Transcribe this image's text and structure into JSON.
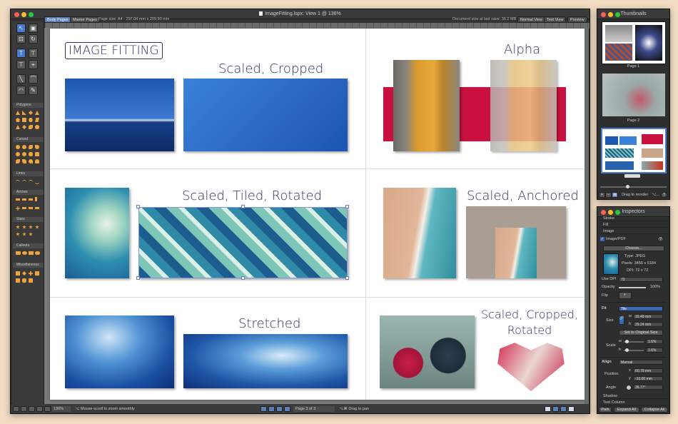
{
  "main_window": {
    "title": "ImageFitting.lspx: View 1 @ 136%",
    "tabs": {
      "body_pages": "Body Pages",
      "master_pages": "Master Pages"
    },
    "page_size": "Page size:  A4 - 297.04 mm x 209.90 mm",
    "doc_size": "Document size at last save:  36.2 MB",
    "view_buttons": {
      "normal": "Normal View",
      "text": "Text View",
      "preview": "Preview"
    },
    "toolbox_sections": [
      "Polygons",
      "Curved",
      "Lines",
      "Arrows",
      "Stars",
      "Callouts",
      "Miscellaneous"
    ],
    "status": {
      "zoom": "136%",
      "hint_left": "⌥ Mouse-scroll to zoom smoothly",
      "page": "Page 3 of 3",
      "hint_right": "⌥⌘ Drag to pan"
    }
  },
  "page": {
    "titles": {
      "image_fitting": "IMAGE FITTING",
      "scaled_cropped": "Scaled, Cropped",
      "alpha": "Alpha",
      "scaled_tiled_rotated": "Scaled, Tiled, Rotated",
      "scaled_anchored": "Scaled, Anchored",
      "stretched": "Stretched",
      "scaled_cropped_rotated": "Scaled, Cropped,\nRotated"
    }
  },
  "thumbnails": {
    "title": "Thumbnails",
    "pages": [
      "Page 1",
      "Page 2"
    ],
    "drag_hint": "Drag to reorder",
    "drag_hint_key": "⌥..."
  },
  "inspectors": {
    "title": "Inspectors",
    "sections": {
      "stroke": "Stroke",
      "fill": "Fill",
      "image": "Image",
      "shadow": "Shadow",
      "text_column": "Text Column"
    },
    "image_pdf_label": "Image/PDF",
    "choose_button": "Choose...",
    "type": "Type:  JPEG",
    "pixels": "Pixels:  3456 x 5184",
    "dpi": "DPI:  72 x 72",
    "use_dpi_label": "Use DPI",
    "use_dpi_value": "72",
    "opacity_label": "Opacity",
    "opacity_value": "100%",
    "opacity_fraction": 1.0,
    "flip_label": "Flip",
    "fit_label": "Fit",
    "fit_value": "Tile",
    "size_label": "Size",
    "w_label": "w",
    "h_label": "h",
    "size_w": "15.49 mm",
    "size_h": "29.24 mm",
    "set_original_size": "Set to Original Size",
    "scale_label": "Scale",
    "scale_w": "1.6%",
    "scale_h": "1.6%",
    "align_label": "Align",
    "align_value": "Manual",
    "position_label": "Position",
    "x_label": "x",
    "y_label": "y",
    "pos_x": "60.79 mm",
    "pos_y": "-10.00 mm",
    "angle_label": "Angle",
    "angle_value": "36.77°",
    "buttons": {
      "park": "Park",
      "expand_all": "Expand All",
      "collapse_all": "Collapse All"
    }
  }
}
